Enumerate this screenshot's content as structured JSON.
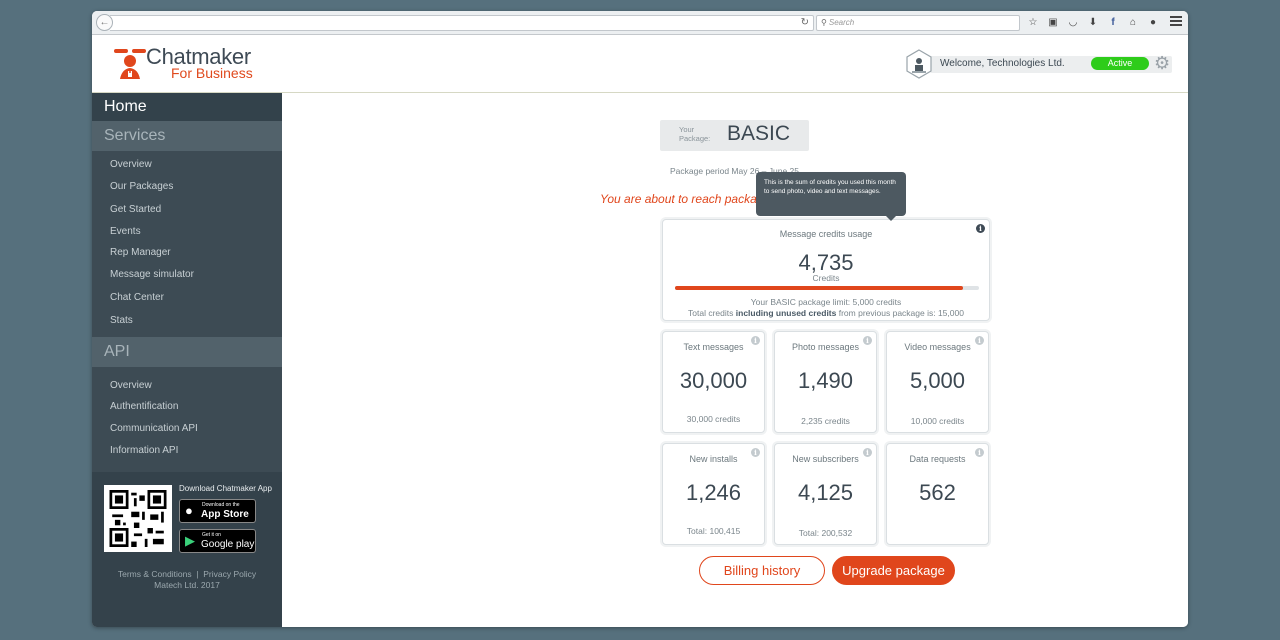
{
  "browser": {
    "search_placeholder": "Search",
    "toolbar_icons": [
      "star-icon",
      "clipboard-icon",
      "pocket-icon",
      "download-icon",
      "facebook-icon",
      "home-icon",
      "chat-icon"
    ]
  },
  "header": {
    "brand_name": "Chatmaker",
    "brand_sub": "For Business",
    "welcome": "Welcome, Technologies Ltd.",
    "status": "Active"
  },
  "sidebar": {
    "home": "Home",
    "services_title": "Services",
    "services": [
      "Overview",
      "Our Packages",
      "Get Started",
      "Events",
      "Rep Manager",
      "Message simulator",
      "Chat Center",
      "Stats"
    ],
    "api_title": "API",
    "api": [
      "Overview",
      "Authentification",
      "Communication API",
      "Information API"
    ],
    "download_label": "Download Chatmaker App",
    "appstore_small": "Download on the",
    "appstore_big": "App Store",
    "googleplay_small": "Get it on",
    "googleplay_big": "Google play",
    "footer_links": "Terms & Conditions  |  Privacy Policy",
    "footer_copy": "Matech Ltd. 2017"
  },
  "main": {
    "package_label": "Your Package:",
    "package_name": "BASIC",
    "package_period": "Package period May 26 – June 25",
    "warning": "You are about to reach package limit",
    "tooltip": "This is the sum of credits you used this month to send photo, video and text messages.",
    "usage": {
      "title": "Message credits usage",
      "value": "4,735",
      "unit": "Credits",
      "progress": 0.947,
      "limit_text": "Your BASIC package limit: 5,000 credits",
      "total_prefix": "Total credits",
      "total_bold": "including unused credits",
      "total_suffix": "from previous package is: 15,000"
    },
    "stats": [
      {
        "title": "Text messages",
        "value": "30,000",
        "sub": "30,000 credits"
      },
      {
        "title": "Photo messages",
        "value": "1,490",
        "sub": "2,235 credits"
      },
      {
        "title": "Video messages",
        "value": "5,000",
        "sub": "10,000 credits"
      },
      {
        "title": "New installs",
        "value": "1,246",
        "sub": "Total: 100,415"
      },
      {
        "title": "New subscribers",
        "value": "4,125",
        "sub": "Total: 200,532"
      },
      {
        "title": "Data requests",
        "value": "562",
        "sub": ""
      }
    ],
    "billing_button": "Billing history",
    "upgrade_button": "Upgrade package"
  },
  "colors": {
    "accent": "#e0461c",
    "active": "#2ecc1a",
    "sidebar": "#3d4b54",
    "background": "#56707d"
  }
}
